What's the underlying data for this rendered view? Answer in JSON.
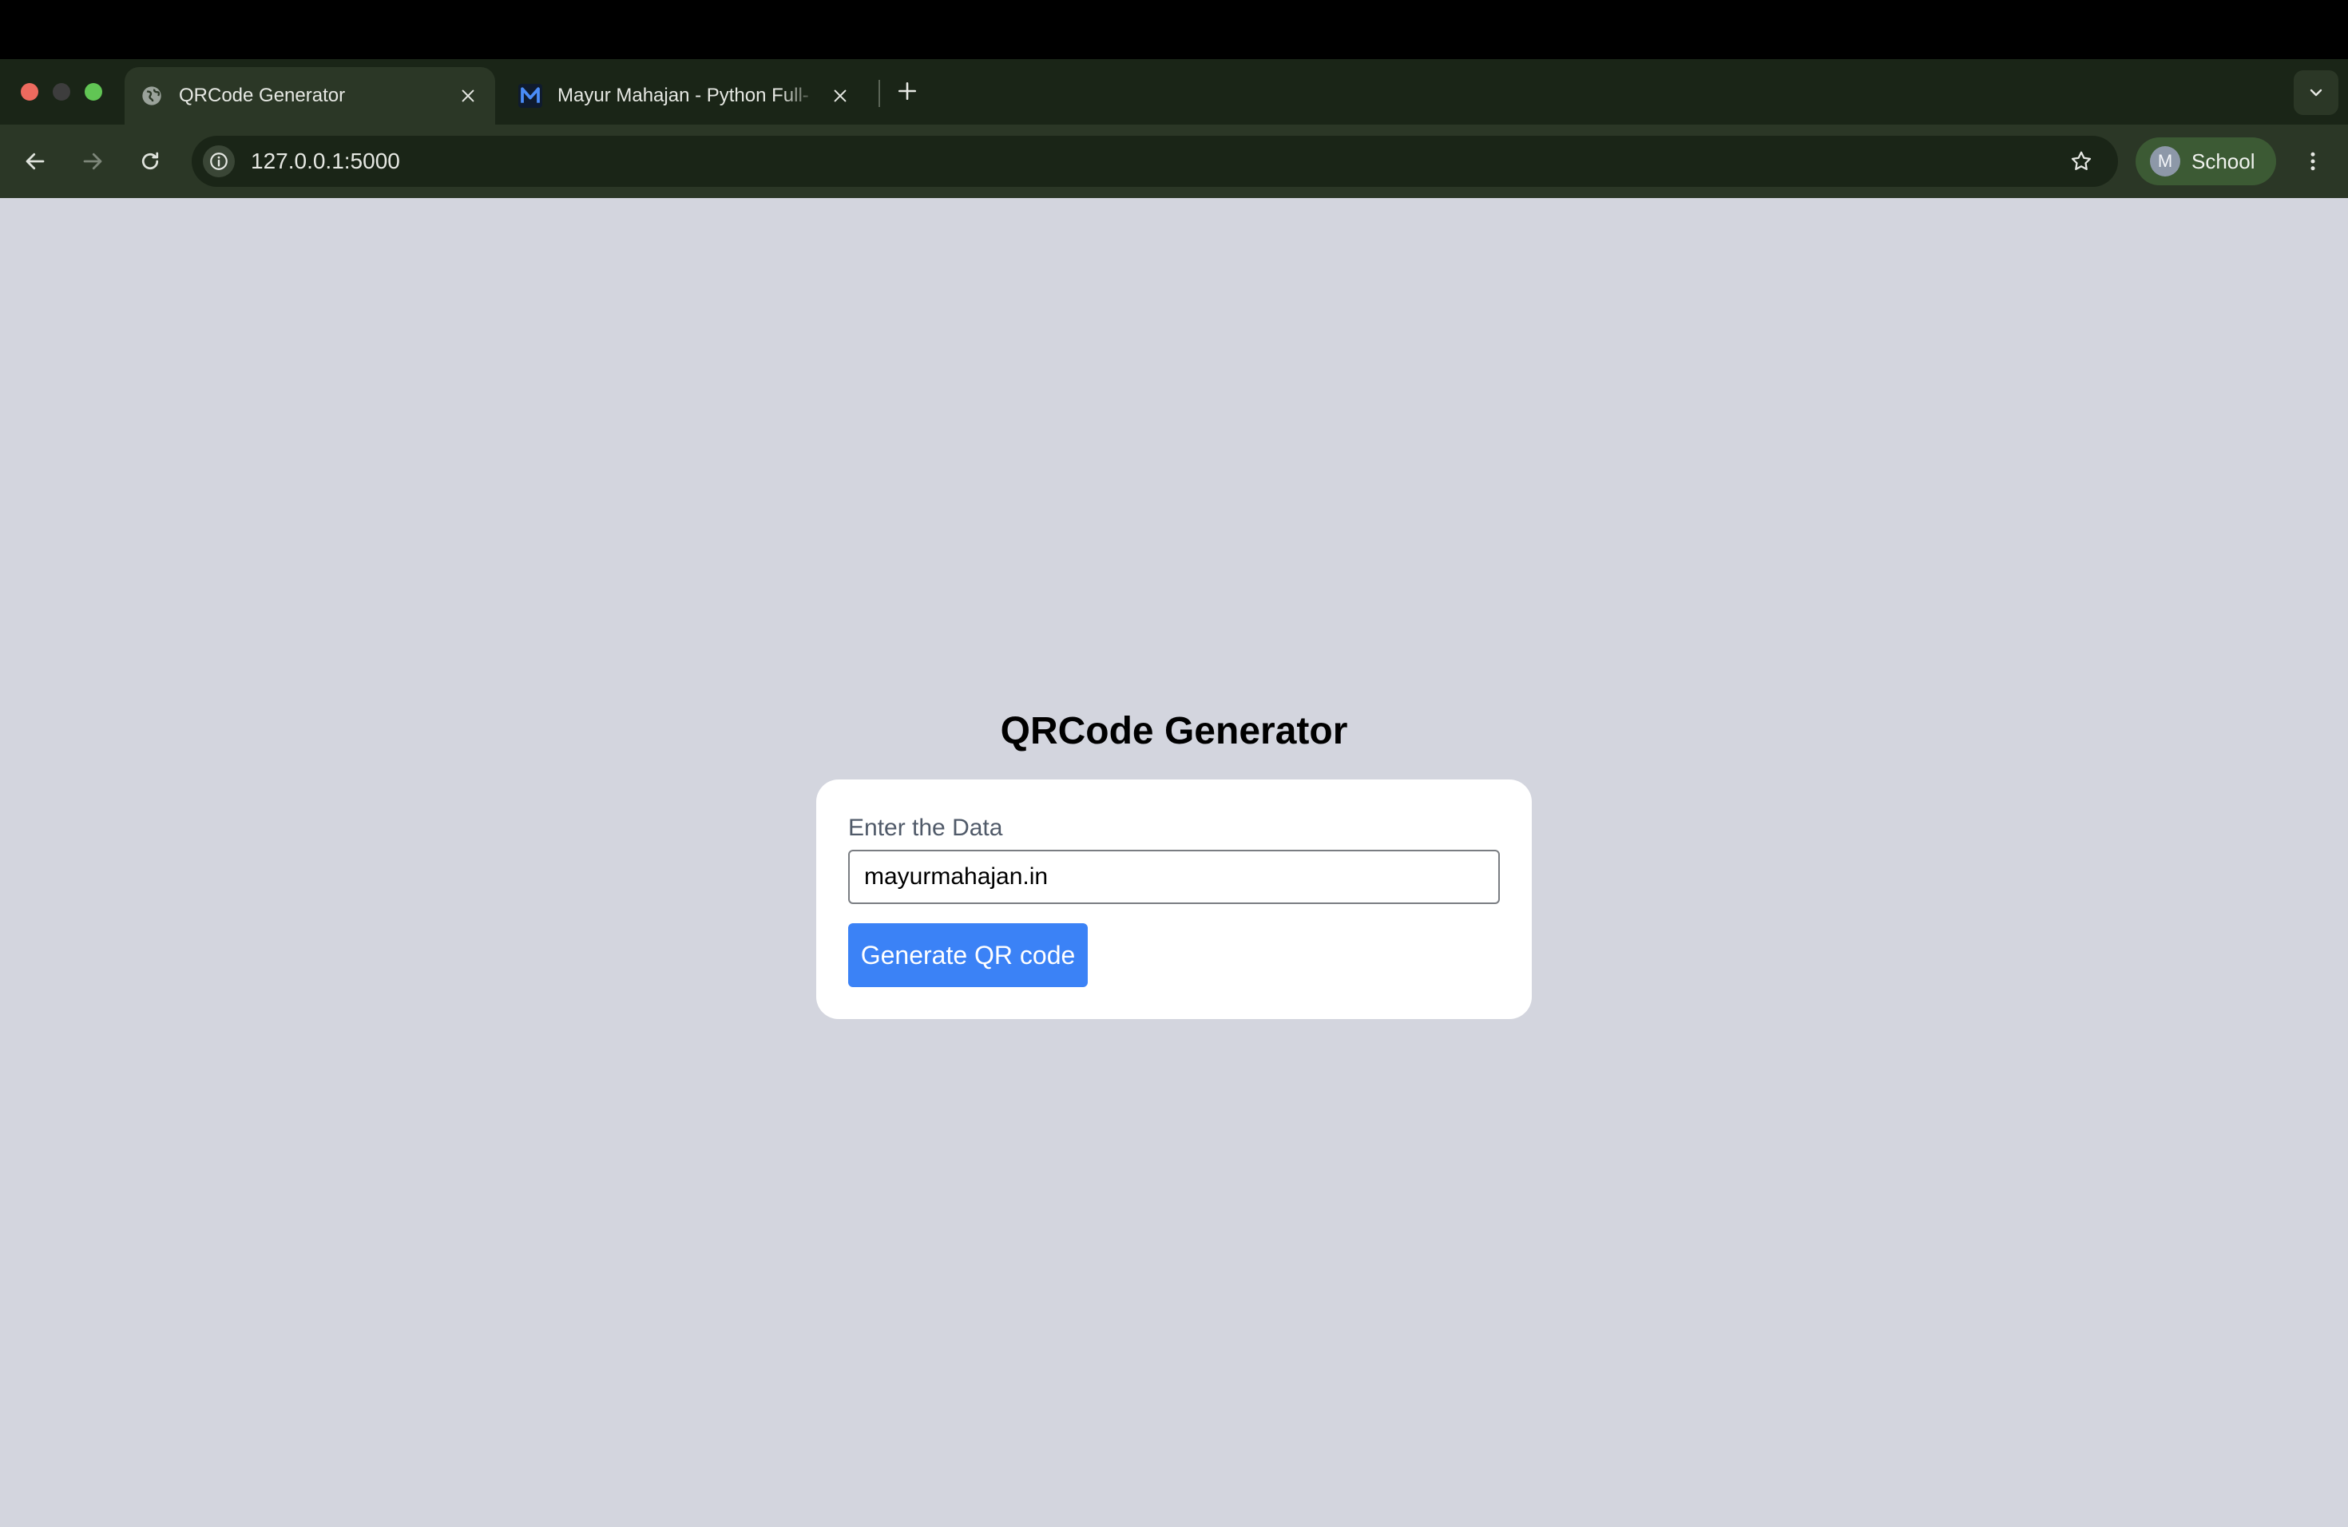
{
  "browser": {
    "tabs": [
      {
        "title": "QRCode Generator",
        "active": true,
        "icon": "globe-icon"
      },
      {
        "title": "Mayur Mahajan - Python Full-",
        "active": false,
        "icon": "m-logo-icon"
      }
    ],
    "address_bar": {
      "url": "127.0.0.1:5000"
    },
    "profile": {
      "initial": "M",
      "name": "School"
    }
  },
  "page": {
    "title": "QRCode Generator",
    "form": {
      "label": "Enter the Data",
      "input_value": "mayurmahajan.in",
      "button_label": "Generate QR code"
    }
  },
  "colors": {
    "page_background": "#d3d5de",
    "button_blue": "#3b82f6",
    "browser_frame": "#2b3726"
  }
}
